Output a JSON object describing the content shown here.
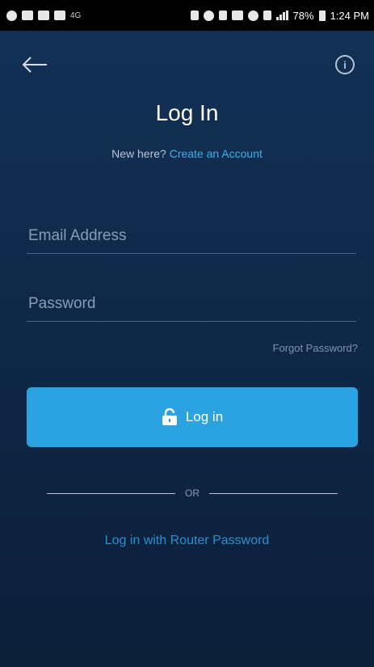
{
  "status_bar": {
    "lte": "4G",
    "battery": "78%",
    "time": "1:24 PM"
  },
  "header": {
    "back_icon": "arrow-left-icon",
    "info_icon": "info-icon",
    "title": "Log In"
  },
  "signup": {
    "prompt": "New here?",
    "link": "Create an Account"
  },
  "form": {
    "email_placeholder": "Email Address",
    "email_value": "",
    "password_placeholder": "Password",
    "password_value": "",
    "forgot_label": "Forgot Password?",
    "login_label": "Log in",
    "login_icon": "lock-icon"
  },
  "divider": {
    "label": "OR"
  },
  "alt_login": {
    "label": "Log in with Router Password"
  },
  "colors": {
    "background": "#0f2340",
    "accent": "#2aa3e0",
    "link": "#3fb0e8"
  }
}
